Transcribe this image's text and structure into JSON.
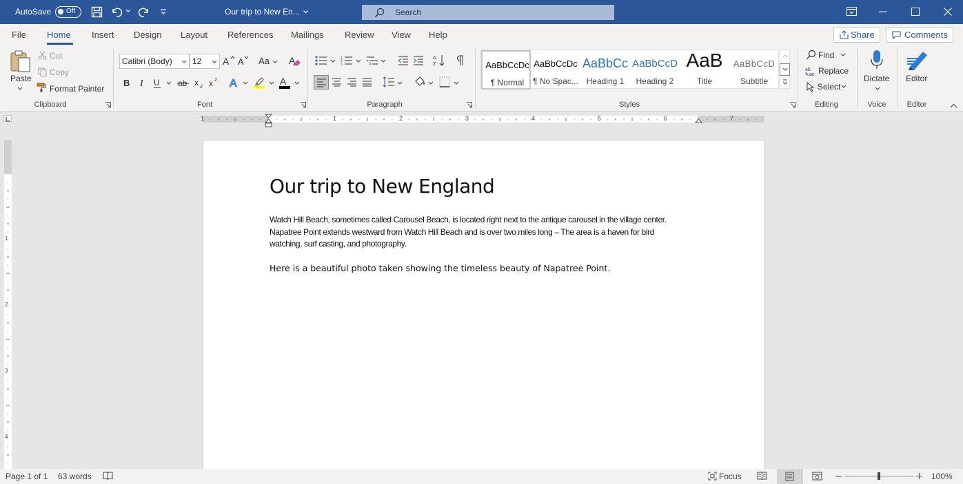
{
  "titlebar": {
    "autosave_label": "AutoSave",
    "autosave_state": "Off",
    "document_title": "Our trip to New En...",
    "search_placeholder": "Search",
    "bg_color": "#2b579a"
  },
  "menu": {
    "tabs": [
      {
        "label": "File"
      },
      {
        "label": "Home"
      },
      {
        "label": "Insert"
      },
      {
        "label": "Design"
      },
      {
        "label": "Layout"
      },
      {
        "label": "References"
      },
      {
        "label": "Mailings"
      },
      {
        "label": "Review"
      },
      {
        "label": "View"
      },
      {
        "label": "Help"
      }
    ],
    "active_tab": "Home",
    "share_label": "Share",
    "comments_label": "Comments"
  },
  "ribbon": {
    "clipboard": {
      "paste": "Paste",
      "cut": "Cut",
      "copy": "Copy",
      "format_painter": "Format Painter",
      "group": "Clipboard"
    },
    "font": {
      "font_name": "Calibri (Body)",
      "font_size": "12",
      "change_case": "Aa",
      "group": "Font"
    },
    "paragraph": {
      "group": "Paragraph"
    },
    "styles": {
      "items": [
        {
          "preview": "AaBbCcDc",
          "name": "¶ Normal"
        },
        {
          "preview": "AaBbCcDc",
          "name": "¶ No Spac..."
        },
        {
          "preview": "AaBbCc",
          "name": "Heading 1"
        },
        {
          "preview": "AaBbCcD",
          "name": "Heading 2"
        },
        {
          "preview": "AaB",
          "name": "Title"
        },
        {
          "preview": "AaBbCcD",
          "name": "Subtitle"
        }
      ],
      "group": "Styles"
    },
    "editing": {
      "find": "Find",
      "replace": "Replace",
      "select": "Select",
      "group": "Editing"
    },
    "voice": {
      "dictate": "Dictate",
      "group": "Voice"
    },
    "editor": {
      "editor": "Editor",
      "group": "Editor"
    }
  },
  "ruler": {
    "h_labels": [
      "1",
      "1",
      "2",
      "3",
      "4",
      "5",
      "6",
      "7"
    ],
    "v_labels": [
      "1",
      "2",
      "3",
      "4"
    ]
  },
  "document": {
    "heading": "Our trip to New England",
    "paragraph1_line1": "Watch Hill Beach, sometimes called Carousel Beach, is located right next to the antique carousel in the village center.",
    "paragraph1_line2": "Napatree Point extends westward from Watch Hill Beach and is over two miles long – The area is a haven for bird",
    "paragraph1_line3": "watching, surf casting, and photography.",
    "paragraph2": "Here is a beautiful photo taken showing the timeless beauty of Napatree Point."
  },
  "status": {
    "page": "Page 1 of 1",
    "words": "63 words",
    "focus": "Focus",
    "zoom": "100%",
    "zoom_level": 1.0
  }
}
